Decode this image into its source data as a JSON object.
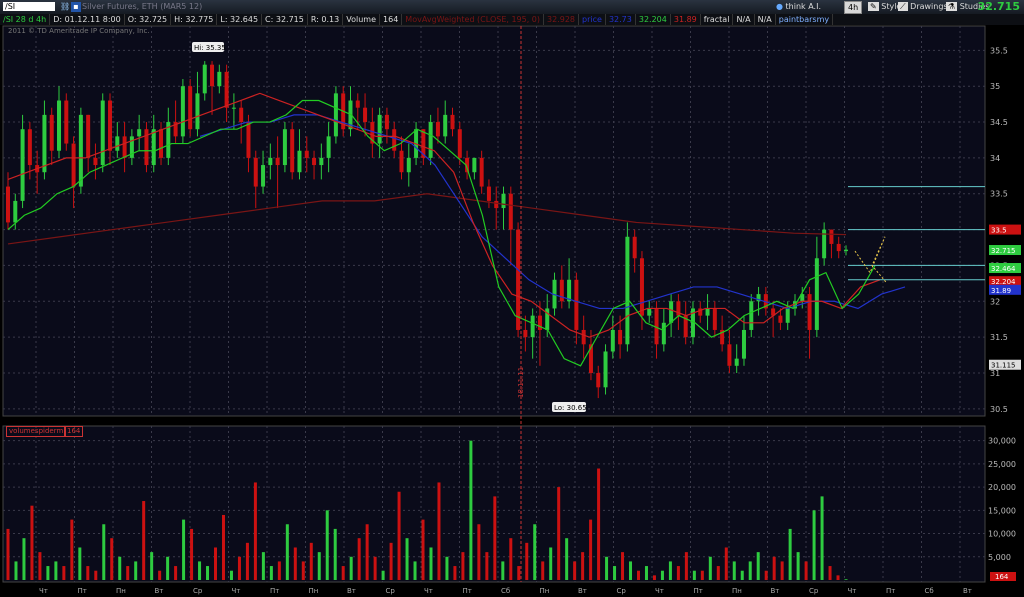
{
  "toolbar": {
    "symbol": "/SI",
    "instrument": "Silver Futures, ETH (MAR5 12)",
    "think_label": "think A.I.",
    "timeframe": "4h",
    "style_label": "Style",
    "drawings_label": "Drawings",
    "studies_label": "Studies",
    "last_price": "32.715"
  },
  "info": {
    "symbol_tf": "/SI 28 d 4h",
    "datetime": "D: 01.12.11 8:00",
    "open": "O: 32.725",
    "high": "H: 32.775",
    "low": "L: 32.645",
    "close": "C: 32.715",
    "range": "R: 0.13",
    "volume_label": "Volume",
    "volume_value": "164",
    "study1": "MovAvgWeighted (CLOSE, 195, 0)",
    "study1_val": "32.928",
    "study2_label": "price",
    "study2_val": "32.73",
    "val3": "32.204",
    "val4": "31.89",
    "fractal": "fractal",
    "na1": "N/A",
    "na2": "N/A",
    "paintbars": "paintbarsmy"
  },
  "copyright": "2011 © TD Ameritrade IP Company, Inc.",
  "volume_study": {
    "label": "volumespiderm",
    "value": "164"
  },
  "colors": {
    "bg": "#0a0b1a",
    "up": "#2ecc40",
    "down": "#cc1111",
    "grid": "#3a3a4a",
    "ma_green": "#22cc22",
    "ma_red": "#cc2222",
    "ma_blue": "#2233cc",
    "ma_darkred": "#7a1515",
    "level": "#6cc"
  },
  "chart_data": {
    "type": "candlestick",
    "timeframe": "4h",
    "price_axis": {
      "ylim": [
        30.4,
        35.7
      ],
      "ticks": [
        30.5,
        31,
        31.5,
        32,
        32.5,
        33,
        33.5,
        34,
        34.5,
        35,
        35.5
      ]
    },
    "volume_axis": {
      "ylim": [
        0,
        31000
      ],
      "ticks": [
        "5,000",
        "10,000",
        "15,000",
        "20,000",
        "25,000",
        "30,000"
      ]
    },
    "x_day_labels": [
      "Чт",
      "Пт",
      "Пн",
      "Вт",
      "Ср",
      "Чт",
      "Пт",
      "Пн",
      "Вт",
      "Ср",
      "Чт",
      "Пт",
      "Сб",
      "Пн",
      "Вт",
      "Ср",
      "Чт",
      "Пт",
      "Пн",
      "Вт",
      "Ср",
      "Чт",
      "Пт",
      "Сб",
      "Вт"
    ],
    "annotations": {
      "high": "Hi: 35.35",
      "low": "Lo: 30.65",
      "date_marker": "18.11.11"
    },
    "price_labels": [
      {
        "text": "33.5",
        "value": 33.0,
        "color": "#cc1111"
      },
      {
        "text": "32.715",
        "value": 32.715,
        "color": "#2ecc40"
      },
      {
        "text": "32.464",
        "value": 32.464,
        "color": "#2ecc40"
      },
      {
        "text": "32.204",
        "value": 32.28,
        "color": "#cc1111"
      },
      {
        "text": "31.89",
        "value": 32.16,
        "color": "#2233cc"
      },
      {
        "text": "31.115",
        "value": 31.115,
        "color": "#dddddd"
      }
    ],
    "levels": [
      33.6,
      33.0,
      32.5,
      32.3
    ],
    "candles": [
      [
        33.6,
        33.1,
        33.8,
        33.0
      ],
      [
        33.1,
        33.4,
        33.5,
        33.0
      ],
      [
        33.4,
        34.4,
        34.6,
        33.3
      ],
      [
        34.4,
        33.9,
        34.5,
        33.7
      ],
      [
        33.9,
        33.8,
        34.1,
        33.5
      ],
      [
        33.8,
        34.6,
        34.8,
        33.7
      ],
      [
        34.6,
        34.1,
        34.7,
        33.9
      ],
      [
        34.1,
        34.8,
        35.0,
        34.0
      ],
      [
        34.8,
        34.2,
        34.9,
        34.1
      ],
      [
        34.2,
        33.6,
        34.3,
        33.3
      ],
      [
        33.6,
        34.6,
        34.7,
        33.5
      ],
      [
        34.6,
        34.0,
        34.6,
        33.8
      ],
      [
        34.0,
        33.9,
        34.2,
        33.7
      ],
      [
        33.9,
        34.8,
        34.9,
        33.8
      ],
      [
        34.8,
        34.1,
        34.9,
        33.9
      ],
      [
        34.1,
        34.3,
        34.5,
        34.0
      ],
      [
        34.3,
        34.0,
        34.5,
        33.8
      ],
      [
        34.0,
        34.3,
        34.4,
        33.9
      ],
      [
        34.3,
        34.4,
        34.6,
        34.1
      ],
      [
        34.4,
        33.9,
        34.5,
        33.8
      ],
      [
        33.9,
        34.4,
        34.6,
        33.8
      ],
      [
        34.4,
        34.0,
        34.5,
        33.9
      ],
      [
        34.0,
        34.5,
        34.7,
        33.9
      ],
      [
        34.5,
        34.3,
        34.8,
        34.2
      ],
      [
        34.3,
        35.0,
        35.1,
        34.2
      ],
      [
        35.0,
        34.4,
        35.1,
        34.3
      ],
      [
        34.4,
        34.9,
        35.2,
        34.3
      ],
      [
        34.9,
        35.3,
        35.35,
        34.8
      ],
      [
        35.3,
        35.0,
        35.35,
        34.6
      ],
      [
        35.0,
        35.2,
        35.3,
        34.9
      ],
      [
        35.2,
        34.7,
        35.3,
        34.5
      ],
      [
        34.7,
        34.7,
        34.9,
        34.4
      ],
      [
        34.7,
        34.5,
        34.8,
        34.2
      ],
      [
        34.5,
        34.0,
        34.6,
        33.8
      ],
      [
        34.0,
        33.6,
        34.1,
        33.3
      ],
      [
        33.6,
        33.9,
        34.1,
        33.5
      ],
      [
        33.9,
        34.0,
        34.2,
        33.7
      ],
      [
        34.0,
        33.9,
        34.3,
        33.3
      ],
      [
        33.9,
        34.4,
        34.5,
        33.8
      ],
      [
        34.4,
        33.8,
        34.5,
        33.7
      ],
      [
        33.8,
        34.1,
        34.4,
        33.7
      ],
      [
        34.1,
        34.0,
        34.3,
        33.8
      ],
      [
        34.0,
        33.9,
        34.1,
        33.7
      ],
      [
        33.9,
        34.0,
        34.2,
        33.7
      ],
      [
        34.0,
        34.3,
        34.5,
        33.8
      ],
      [
        34.3,
        34.9,
        35.0,
        34.2
      ],
      [
        34.9,
        34.4,
        35.0,
        34.3
      ],
      [
        34.4,
        34.8,
        35.0,
        34.3
      ],
      [
        34.8,
        34.7,
        34.9,
        34.4
      ],
      [
        34.7,
        34.5,
        34.9,
        34.3
      ],
      [
        34.5,
        34.2,
        34.7,
        34.0
      ],
      [
        34.2,
        34.6,
        34.7,
        34.0
      ],
      [
        34.6,
        34.4,
        34.7,
        34.2
      ],
      [
        34.4,
        34.1,
        34.5,
        34.0
      ],
      [
        34.1,
        33.8,
        34.3,
        33.7
      ],
      [
        33.8,
        34.0,
        34.2,
        33.6
      ],
      [
        34.0,
        34.4,
        34.5,
        33.9
      ],
      [
        34.4,
        34.0,
        34.4,
        33.9
      ],
      [
        34.0,
        34.5,
        34.6,
        33.9
      ],
      [
        34.5,
        34.3,
        34.7,
        34.2
      ],
      [
        34.3,
        34.6,
        34.8,
        34.2
      ],
      [
        34.6,
        34.4,
        34.7,
        34.3
      ],
      [
        34.4,
        34.0,
        34.5,
        33.9
      ],
      [
        34.0,
        33.8,
        34.1,
        33.7
      ],
      [
        33.8,
        34.0,
        34.0,
        33.7
      ],
      [
        34.0,
        33.6,
        34.1,
        33.5
      ],
      [
        33.6,
        33.4,
        33.7,
        33.3
      ],
      [
        33.4,
        33.3,
        33.6,
        33.0
      ],
      [
        33.3,
        33.5,
        33.6,
        33.0
      ],
      [
        33.5,
        33.0,
        33.6,
        32.5
      ],
      [
        33.0,
        31.6,
        33.1,
        31.5
      ],
      [
        31.6,
        31.5,
        31.8,
        31.3
      ],
      [
        31.5,
        31.8,
        31.9,
        31.2
      ],
      [
        31.8,
        31.6,
        32.0,
        31.1
      ],
      [
        31.6,
        31.9,
        32.1,
        31.5
      ],
      [
        31.9,
        32.3,
        32.4,
        31.8
      ],
      [
        32.3,
        32.0,
        32.5,
        31.9
      ],
      [
        32.0,
        32.3,
        32.6,
        31.9
      ],
      [
        32.3,
        31.6,
        32.4,
        31.4
      ],
      [
        31.6,
        31.4,
        31.8,
        31.2
      ],
      [
        31.4,
        31.0,
        31.6,
        30.9
      ],
      [
        31.0,
        30.8,
        31.1,
        30.65
      ],
      [
        30.8,
        31.3,
        31.4,
        30.7
      ],
      [
        31.3,
        31.6,
        31.8,
        31.2
      ],
      [
        31.6,
        31.4,
        31.8,
        31.2
      ],
      [
        31.4,
        32.9,
        33.1,
        31.3
      ],
      [
        32.9,
        32.6,
        33.0,
        32.4
      ],
      [
        32.6,
        31.8,
        32.7,
        31.6
      ],
      [
        31.8,
        31.9,
        32.0,
        31.7
      ],
      [
        31.9,
        31.4,
        32.0,
        31.2
      ],
      [
        31.4,
        31.7,
        31.9,
        31.3
      ],
      [
        31.7,
        32.0,
        32.1,
        31.5
      ],
      [
        32.0,
        31.8,
        32.1,
        31.6
      ],
      [
        31.8,
        31.5,
        32.0,
        31.4
      ],
      [
        31.5,
        31.9,
        32.0,
        31.4
      ],
      [
        31.9,
        31.8,
        32.0,
        31.7
      ],
      [
        31.8,
        31.9,
        32.1,
        31.6
      ],
      [
        31.9,
        31.6,
        32.0,
        31.5
      ],
      [
        31.6,
        31.4,
        31.8,
        31.3
      ],
      [
        31.4,
        31.1,
        31.6,
        31.0
      ],
      [
        31.1,
        31.2,
        31.4,
        31.0
      ],
      [
        31.2,
        31.6,
        31.8,
        31.1
      ],
      [
        31.6,
        32.0,
        32.1,
        31.5
      ],
      [
        32.0,
        32.1,
        32.2,
        31.8
      ],
      [
        32.1,
        31.9,
        32.2,
        31.8
      ],
      [
        31.9,
        31.8,
        32.0,
        31.5
      ],
      [
        31.8,
        31.7,
        31.9,
        31.6
      ],
      [
        31.7,
        31.9,
        32.0,
        31.6
      ],
      [
        31.9,
        32.0,
        32.1,
        31.8
      ],
      [
        32.0,
        32.1,
        32.2,
        31.9
      ],
      [
        32.1,
        31.6,
        32.2,
        31.2
      ],
      [
        31.6,
        32.6,
        32.9,
        31.5
      ],
      [
        32.6,
        33.0,
        33.1,
        32.5
      ],
      [
        33.0,
        32.8,
        33.0,
        32.6
      ],
      [
        32.8,
        32.7,
        32.9,
        32.6
      ],
      [
        32.7,
        32.72,
        32.78,
        32.64
      ]
    ],
    "ma_green": [
      33.0,
      33.2,
      33.3,
      33.5,
      33.6,
      33.8,
      33.9,
      34.0,
      34.1,
      34.1,
      34.2,
      34.2,
      34.3,
      34.4,
      34.4,
      34.5,
      34.5,
      34.6,
      34.8,
      34.8,
      34.7,
      34.6,
      34.3,
      34.1,
      34.2,
      34.4,
      34.3,
      34.1,
      33.9,
      33.2,
      32.2,
      31.8,
      31.7,
      31.6,
      31.2,
      31.1,
      31.5,
      31.9,
      32.0,
      31.7,
      31.6,
      31.8,
      31.7,
      31.5,
      31.6,
      31.8,
      31.9,
      32.0,
      31.9,
      32.3,
      32.4,
      31.9,
      32.1,
      32.5
    ],
    "ma_red": [
      33.7,
      33.8,
      33.9,
      34.0,
      34.0,
      34.1,
      34.2,
      34.3,
      34.4,
      34.5,
      34.6,
      34.7,
      34.8,
      34.9,
      34.8,
      34.7,
      34.6,
      34.5,
      34.4,
      34.3,
      34.3,
      34.2,
      34.1,
      33.8,
      33.1,
      32.5,
      32.1,
      32.0,
      31.8,
      31.6,
      31.5,
      31.6,
      31.8,
      31.9,
      31.9,
      31.8,
      31.9,
      31.9,
      31.7,
      31.7,
      31.9,
      32.0,
      32.0,
      31.9,
      32.2,
      32.3
    ],
    "ma_blue": [
      34.3,
      34.4,
      34.5,
      34.5,
      34.6,
      34.6,
      34.5,
      34.4,
      34.3,
      34.2,
      33.9,
      33.4,
      32.9,
      32.6,
      32.3,
      32.1,
      32.0,
      31.9,
      31.9,
      32.0,
      32.1,
      32.2,
      32.2,
      32.1,
      32.0,
      31.9,
      32.0,
      32.0,
      31.9,
      32.1,
      32.2
    ],
    "ma_darkred": [
      32.8,
      32.9,
      33.0,
      33.1,
      33.2,
      33.3,
      33.4,
      33.4,
      33.5,
      33.4,
      33.3,
      33.2,
      33.1,
      33.05,
      33.0,
      32.95,
      32.93
    ],
    "volume": [
      11000,
      4000,
      9000,
      16000,
      6000,
      3000,
      4000,
      3000,
      13000,
      7000,
      3000,
      2000,
      12000,
      9000,
      5000,
      3000,
      4000,
      17000,
      6000,
      2000,
      5000,
      3000,
      13000,
      11000,
      4000,
      3000,
      7000,
      14000,
      2000,
      5000,
      8000,
      21000,
      6000,
      3000,
      4000,
      12000,
      7000,
      4000,
      8000,
      6000,
      15000,
      11000,
      3000,
      5000,
      9000,
      12000,
      5000,
      2000,
      8000,
      19000,
      9000,
      4000,
      13000,
      7000,
      21000,
      5000,
      3000,
      6000,
      30000,
      12000,
      6000,
      18000,
      4000,
      9000,
      3000,
      8000,
      12000,
      4000,
      7000,
      20000,
      9000,
      4000,
      6000,
      13000,
      24000,
      5000,
      3000,
      6000,
      4000,
      2000,
      3000,
      1000,
      2000,
      4000,
      3000,
      6000,
      2000,
      2000,
      5000,
      3000,
      7000,
      4000,
      2000,
      4000,
      6000,
      2000,
      5000,
      4000,
      11000,
      6000,
      4000,
      15000,
      18000,
      3000,
      1000,
      164
    ]
  }
}
